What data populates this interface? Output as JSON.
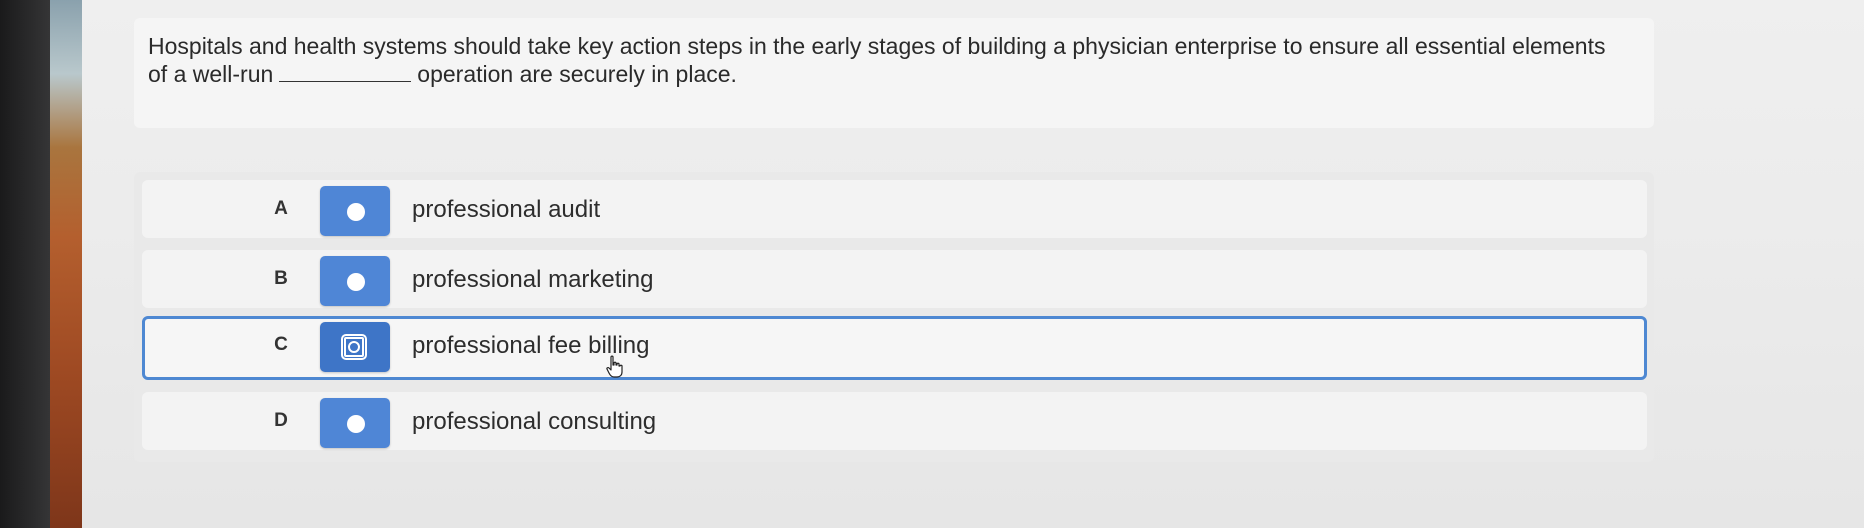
{
  "question": {
    "text_before": "Hospitals and health systems should take key action steps in the early stages of building a physician enterprise to ensure all essential elements of a well-run",
    "text_after": "operation are securely in place."
  },
  "options": [
    {
      "letter": "A",
      "label": "professional audit",
      "selected": false
    },
    {
      "letter": "B",
      "label": "professional marketing",
      "selected": false
    },
    {
      "letter": "C",
      "label": "professional fee billing",
      "selected": true
    },
    {
      "letter": "D",
      "label": "professional consulting",
      "selected": false
    }
  ],
  "colors": {
    "accent": "#4f86d6",
    "selected_border": "#4e88d2"
  },
  "icons": {
    "cursor": "hand-pointer-icon"
  }
}
